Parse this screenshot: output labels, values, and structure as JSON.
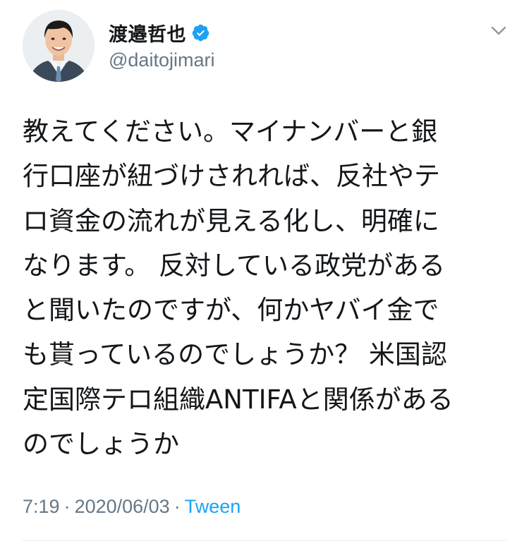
{
  "user": {
    "display_name": "渡邉哲也",
    "handle": "@daitojimari",
    "verified": true,
    "avatar_icon": "profile-photo"
  },
  "tweet": {
    "lines": [
      "教えてください。マイナンバーと銀",
      "行口座が紐づけされれば、反社やテ",
      "ロ資金の流れが見える化し、明確に",
      "なります。 反対している政党がある",
      "と聞いたのですが、何かヤバイ金で",
      "も貰っているのでしょうか？ 米国認",
      "定国際テロ組織ANTIFAと関係がある",
      "のでしょうか"
    ],
    "time": "7:19",
    "separator": "·",
    "date": "2020/06/03",
    "client": "Tween"
  },
  "colors": {
    "text": "#14171a",
    "secondary": "#657786",
    "accent": "#1da1f2",
    "divider": "#e6ecf0"
  },
  "icons": {
    "verified": "verified-badge-icon",
    "menu": "chevron-down-icon"
  }
}
